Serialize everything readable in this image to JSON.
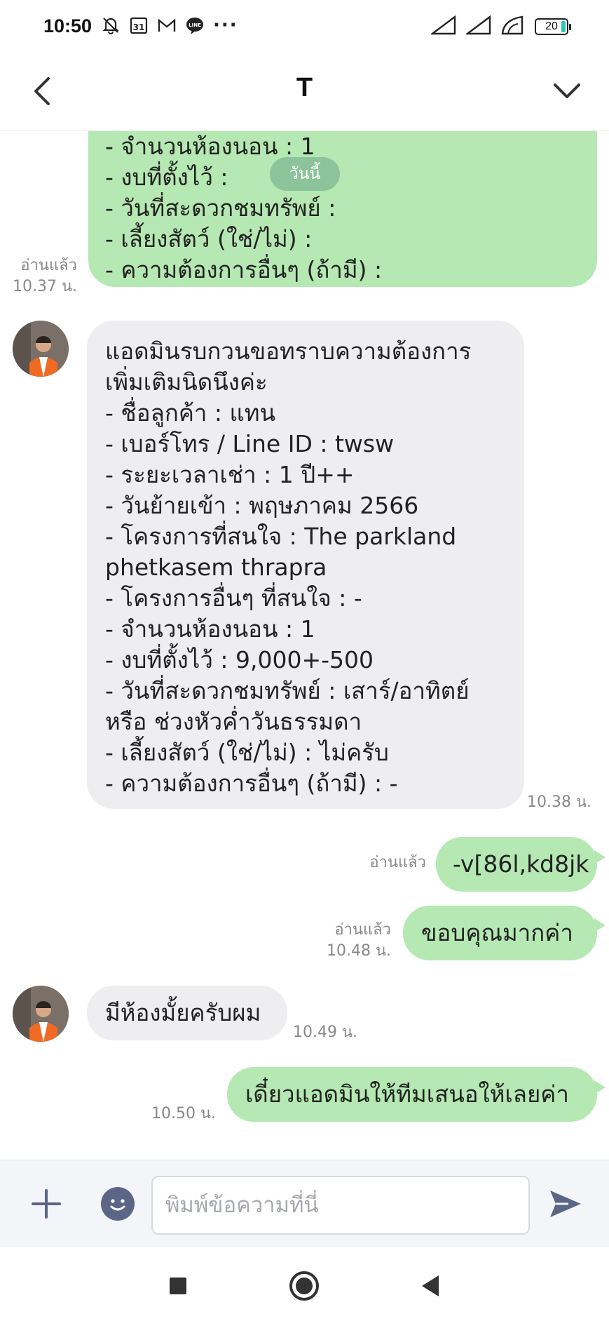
{
  "status_bar": {
    "time": "10:50",
    "more": "···",
    "battery": "20"
  },
  "header": {
    "title": "T"
  },
  "messages": {
    "m1": {
      "lines": [
        "- จำนวนห้องนอน : 1",
        "- งบที่ตั้งไว้ :",
        "- วันที่สะดวกชมทรัพย์ :",
        "- เลี้ยงสัตว์ (ใช่/ไม่) :",
        "- ความต้องการอื่นๆ (ถ้ามี) :"
      ],
      "read": "อ่านแล้ว",
      "time": "10.37 น."
    },
    "date_chip": "วันนี้",
    "m2": {
      "lines": [
        "แอดมินรบกวนขอทราบความต้องการ",
        "เพิ่มเติมนิดนึงค่ะ",
        "- ชื่อลูกค้า : แทน",
        "- เบอร์โทร / Line ID : twsw",
        "- ระยะเวลาเช่า : 1 ปี++",
        "- วันย้ายเข้า : พฤษภาคม 2566",
        "- โครงการที่สนใจ : The parkland",
        "phetkasem thrapra",
        "- โครงการอื่นๆ ที่สนใจ : -",
        "- จำนวนห้องนอน : 1",
        "- งบที่ตั้งไว้ :  9,000+-500",
        "- วันที่สะดวกชมทรัพย์ : เสาร์/อาทิตย์",
        "หรือ ช่วงหัวค่ำวันธรรมดา",
        "- เลี้ยงสัตว์ (ใช่/ไม่) : ไม่ครับ",
        "- ความต้องการอื่นๆ (ถ้ามี) : -"
      ],
      "time": "10.38 น."
    },
    "m3": {
      "text": "-v[86l,kd8jk",
      "read": "อ่านแล้ว"
    },
    "m4": {
      "text": "ขอบคุณมากค่า",
      "read": "อ่านแล้ว",
      "time": "10.48 น."
    },
    "m5": {
      "text": "มีห้องมั้ยครับผม",
      "time": "10.49 น."
    },
    "m6": {
      "text": "เดี๋ยวแอดมินให้ทีมเสนอให้เลยค่า",
      "time": "10.50 น."
    }
  },
  "composer": {
    "placeholder": "พิมพ์ข้อความที่นี่"
  },
  "colors": {
    "outgoing_bubble": "#b5e8b2",
    "incoming_bubble": "#eeeef0",
    "accent": "#5b6687"
  }
}
